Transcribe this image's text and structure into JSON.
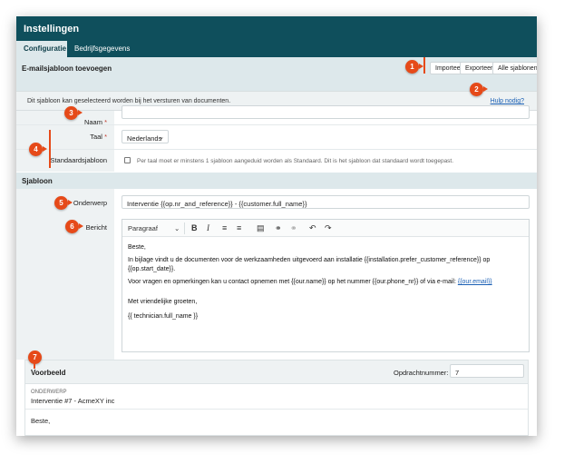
{
  "window": {
    "title": "Instellingen"
  },
  "tabs": [
    {
      "label": "Configuratie"
    },
    {
      "label": "Bedrijfsgegevens"
    }
  ],
  "header": {
    "title": "E-mailsjabloon toevoegen",
    "buttons": {
      "import": "Importeer",
      "export": "Exporteer",
      "all": "Alle sjablonen"
    }
  },
  "info": {
    "text": "Dit sjabloon kan geselecteerd worden bij het versturen van documenten.",
    "help": "Hulp nodig?"
  },
  "form": {
    "name": {
      "label": "Naam",
      "required": "*",
      "value": ""
    },
    "language": {
      "label": "Taal",
      "required": "*",
      "value": "Nederlands"
    },
    "default": {
      "label": "Standaardsjabloon",
      "hint": "Per taal moet er minstens 1 sjabloon aangeduid worden als Standaard. Dit is het sjabloon dat standaard wordt toegepast."
    }
  },
  "template": {
    "section": "Sjabloon",
    "subject_label": "Onderwerp",
    "subject_value": "Interventie {{op.nr_and_reference}} - {{customer.full_name}}",
    "message_label": "Bericht",
    "paragraph_select": "Paragraaf",
    "body": {
      "line1": "Beste,",
      "line2": "In bijlage vindt u de documenten voor de werkzaamheden uitgevoerd aan installatie {{installation.prefer_customer_reference}} op",
      "line3": "{{op.start_date}}.",
      "line4_pre": "Voor vragen en opmerkingen kan u contact opnemen met {{our.name}} op het nummer {{our.phone_nr}} of via e-mail: ",
      "line4_link": "{{our.email}}",
      "line5": "Met vriendelijke groeten,",
      "line6": "{{ technician.full_name }}"
    }
  },
  "preview": {
    "title": "Voorbeeld",
    "order_label": "Opdrachtnummer:",
    "order_value": "7",
    "subject_caption": "ONDERWERP",
    "subject_value": "Interventie #7 - AcmeXY inc",
    "body_start": "Beste,"
  },
  "markers": [
    "1",
    "2",
    "3",
    "4",
    "5",
    "6",
    "7"
  ],
  "colors": {
    "brand": "#0f4f5c",
    "marker": "#e64a19",
    "link": "#1a5fb4"
  }
}
